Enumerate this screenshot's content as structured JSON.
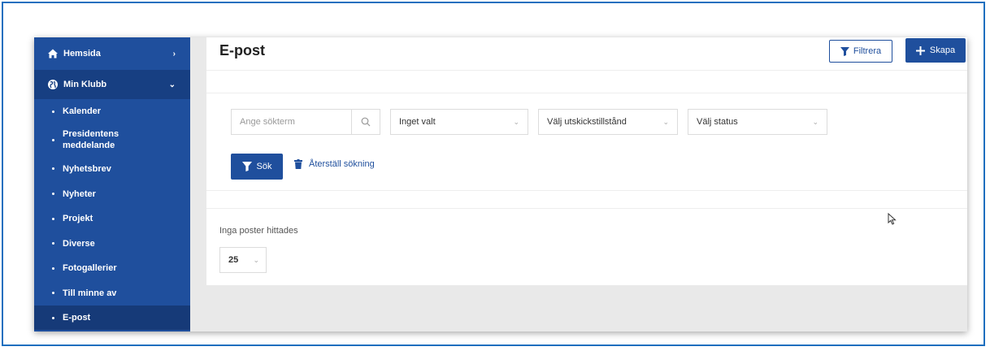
{
  "sidebar": {
    "home": {
      "label": "Hemsida",
      "icon": "home-icon",
      "chevron": "›"
    },
    "club": {
      "label": "Min Klubb",
      "icon": "globe-icon",
      "chevron": "⌄"
    },
    "items": [
      {
        "label": "Kalender"
      },
      {
        "label": "Presidentens meddelande"
      },
      {
        "label": "Nyhetsbrev"
      },
      {
        "label": "Nyheter"
      },
      {
        "label": "Projekt"
      },
      {
        "label": "Diverse"
      },
      {
        "label": "Fotogallerier"
      },
      {
        "label": "Till minne av"
      },
      {
        "label": "E-post"
      }
    ]
  },
  "header": {
    "title": "E-post",
    "filter_label": "Filtrera",
    "create_label": "Skapa"
  },
  "search": {
    "placeholder": "Ange sökterm",
    "selects": [
      "Inget valt",
      "Välj utskickstillstånd",
      "Välj status"
    ],
    "search_label": "Sök",
    "reset_label": "Återställ sökning"
  },
  "results": {
    "empty_text": "Inga poster hittades",
    "page_size": "25"
  },
  "colors": {
    "sidebar": "#1f4f9d",
    "sidebar_active": "#163a78",
    "accent": "#1f4f9d",
    "frame": "#1e6fbf"
  }
}
